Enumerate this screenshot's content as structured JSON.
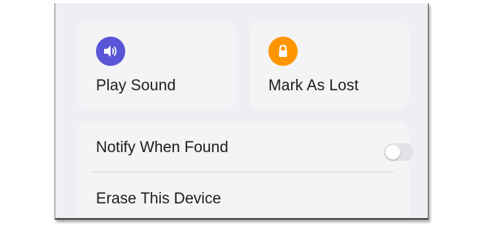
{
  "actions": {
    "play_sound": {
      "label": "Play Sound",
      "icon": "speaker-icon",
      "icon_color": "#5856d6"
    },
    "mark_as_lost": {
      "label": "Mark As Lost",
      "icon": "lock-icon",
      "icon_color": "#ff9500"
    }
  },
  "settings": {
    "notify_when_found": {
      "label": "Notify When Found",
      "enabled": false
    },
    "erase_device": {
      "label": "Erase This Device"
    }
  }
}
